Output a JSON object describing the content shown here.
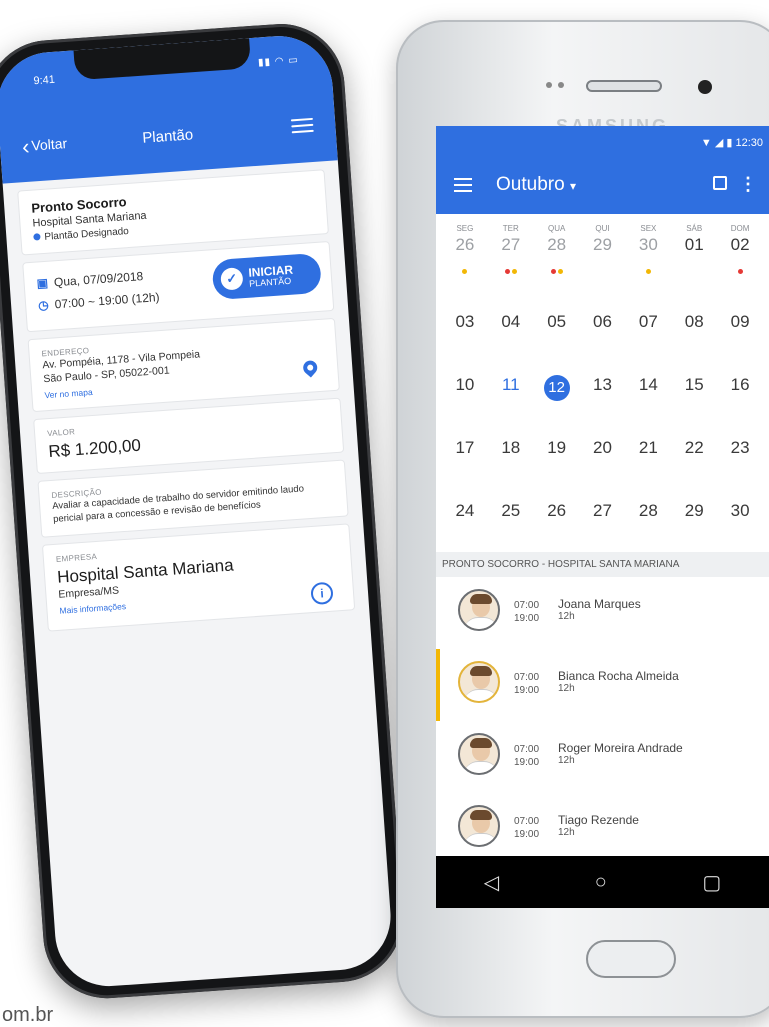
{
  "iphone": {
    "status_time": "9:41",
    "header": {
      "back_label": "Voltar",
      "title": "Plantão"
    },
    "summary": {
      "title": "Pronto Socorro",
      "hospital": "Hospital Santa Mariana",
      "status": "Plantão Designado"
    },
    "schedule": {
      "date": "Qua, 07/09/2018",
      "time": "07:00 ~ 19:00 (12h)",
      "button_line1": "INICIAR",
      "button_line2": "PLANTÃO"
    },
    "address": {
      "label": "ENDEREÇO",
      "line1": "Av. Pompéia, 1178 - Vila Pompeia",
      "line2": "São Paulo - SP, 05022-001",
      "link": "Ver no mapa"
    },
    "value": {
      "label": "VALOR",
      "amount": "R$ 1.200,00"
    },
    "description": {
      "label": "DESCRIÇÃO",
      "text": "Avaliar a capacidade de trabalho do servidor emitindo laudo pericial para a concessão e revisão de benefícios"
    },
    "company": {
      "label": "EMPRESA",
      "name": "Hospital Santa Mariana",
      "sub": "Empresa/MS",
      "link": "Mais informações"
    }
  },
  "android": {
    "brand": "SAMSUNG",
    "status_time": "12:30",
    "month_title": "Outubro",
    "calendar": {
      "first_row": [
        {
          "dow": "SEG",
          "day": "26",
          "dots": [
            "yellow"
          ]
        },
        {
          "dow": "TER",
          "day": "27",
          "dots": [
            "red",
            "yellow"
          ]
        },
        {
          "dow": "QUA",
          "day": "28",
          "dots": [
            "red",
            "yellow"
          ]
        },
        {
          "dow": "QUI",
          "day": "29",
          "dots": []
        },
        {
          "dow": "SEX",
          "day": "30",
          "dots": [
            "yellow"
          ]
        },
        {
          "dow": "SÁB",
          "day": "01",
          "dots": []
        },
        {
          "dow": "DOM",
          "day": "02",
          "dots": [
            "red"
          ]
        }
      ],
      "rows": [
        [
          "03",
          "04",
          "05",
          "06",
          "07",
          "08",
          "09"
        ],
        [
          "10",
          "11",
          "12",
          "13",
          "14",
          "15",
          "16"
        ],
        [
          "17",
          "18",
          "19",
          "20",
          "21",
          "22",
          "23"
        ],
        [
          "24",
          "25",
          "26",
          "27",
          "28",
          "29",
          "30"
        ]
      ],
      "today": "11",
      "selected": "12"
    },
    "section_header": "PRONTO SOCORRO - HOSPITAL SANTA MARIANA",
    "shifts": [
      {
        "start": "07:00",
        "end": "19:00",
        "name": "Joana Marques",
        "duration": "12h"
      },
      {
        "start": "07:00",
        "end": "19:00",
        "name": "Bianca Rocha Almeida",
        "duration": "12h"
      },
      {
        "start": "07:00",
        "end": "19:00",
        "name": "Roger Moreira Andrade",
        "duration": "12h"
      },
      {
        "start": "07:00",
        "end": "19:00",
        "name": "Tiago Rezende",
        "duration": "12h"
      }
    ]
  },
  "footer_text": "om.br",
  "colors": {
    "primary": "#2f6fe0",
    "yellow_dot": "#f2b705",
    "red_dot": "#e53935"
  }
}
